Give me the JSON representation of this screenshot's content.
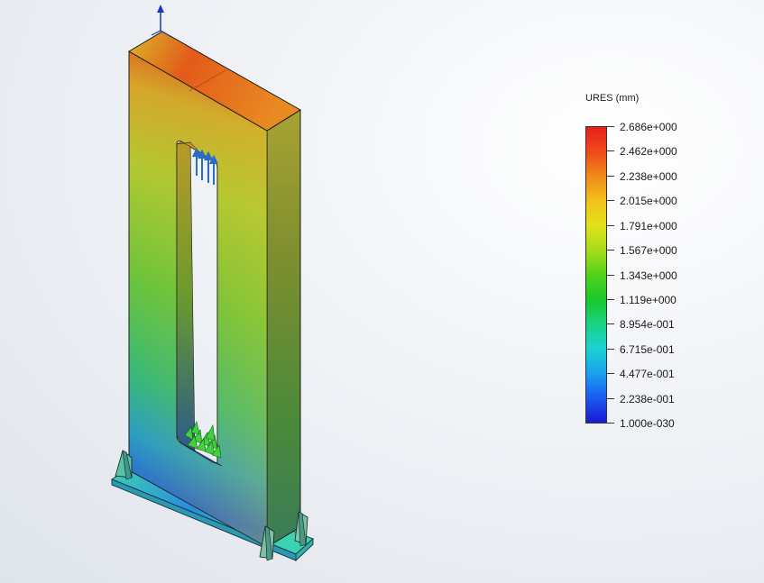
{
  "legend": {
    "title": "URES (mm)",
    "labels": [
      "2.686e+000",
      "2.462e+000",
      "2.238e+000",
      "2.015e+000",
      "1.791e+000",
      "1.567e+000",
      "1.343e+000",
      "1.119e+000",
      "8.954e-001",
      "6.715e-001",
      "4.477e-001",
      "2.238e-001",
      "1.000e-030"
    ]
  },
  "colors": {
    "max": "#e8201a",
    "high": "#f08a1a",
    "mid_high": "#e2e21a",
    "mid": "#52d21a",
    "mid_low": "#1ad2d2",
    "min": "#1a1ad2",
    "fixture_marker": "#3fd23a",
    "load_arrow": "#2a6cc8"
  },
  "icons": {
    "triad": "coordinate-triad-icon",
    "fixtures": "fixed-geometry-icon",
    "load": "load-arrow-icon"
  }
}
